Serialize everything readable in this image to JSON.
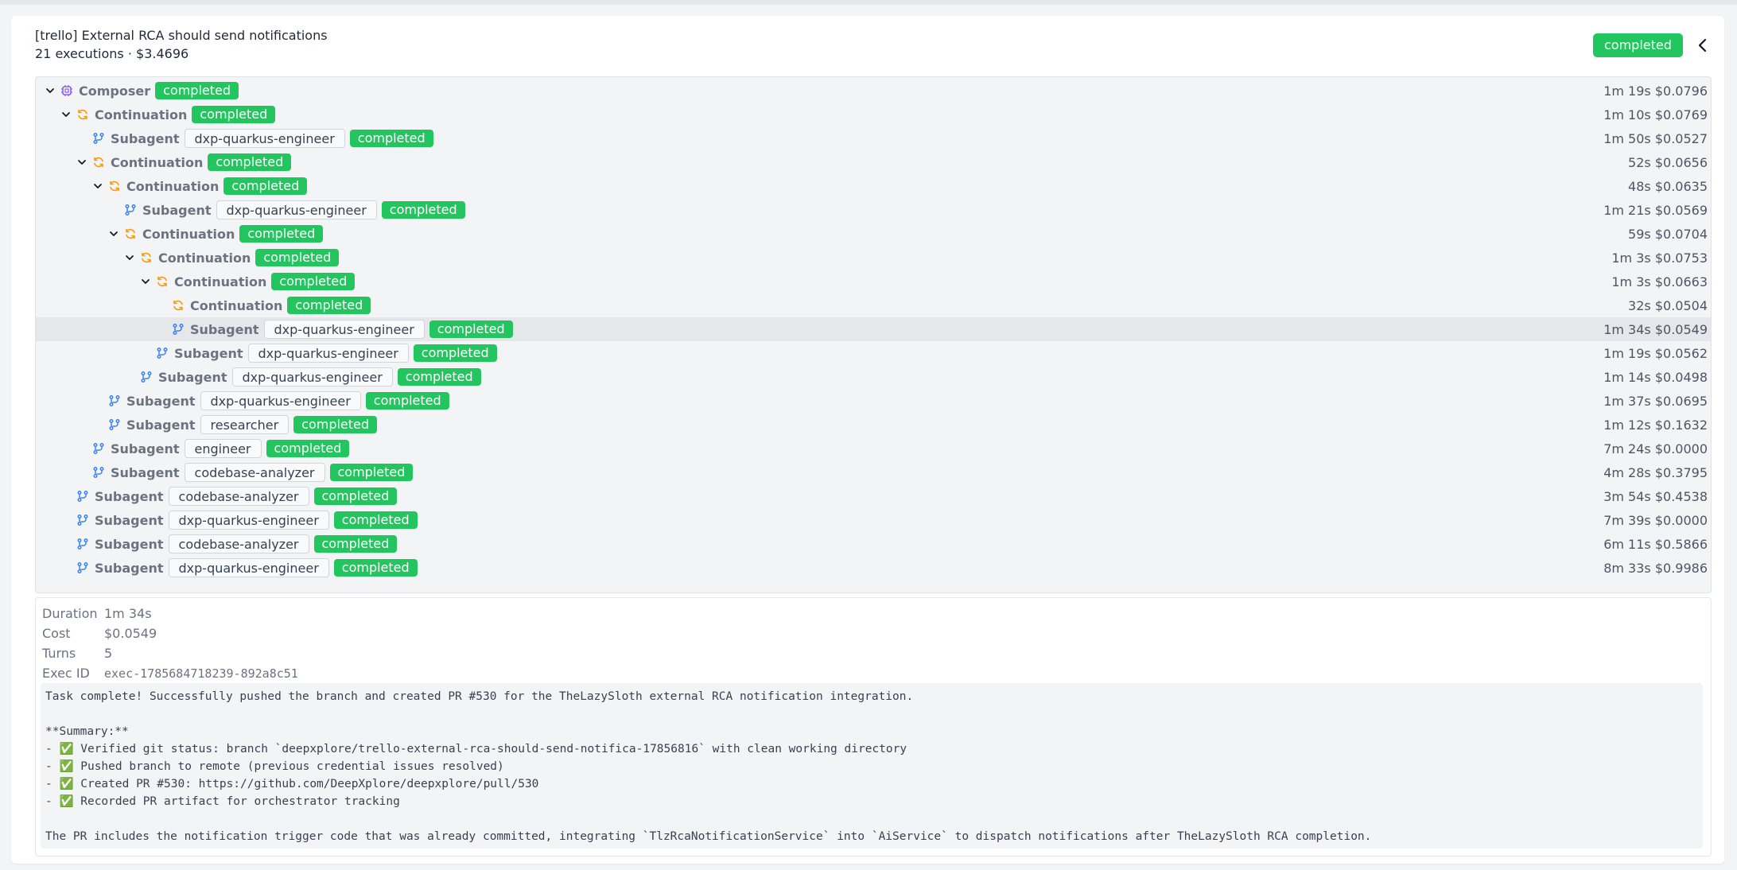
{
  "header": {
    "title": "[trello] External RCA should send notifications",
    "subtitle": "21 executions · $3.4696",
    "status": "completed"
  },
  "tree": [
    {
      "depth": 0,
      "expander": "expanded",
      "type": "composer",
      "label": "Composer",
      "status": "completed",
      "metrics": "1m 19s $0.0796"
    },
    {
      "depth": 1,
      "expander": "expanded",
      "type": "continuation",
      "label": "Continuation",
      "status": "completed",
      "metrics": "1m 10s $0.0769"
    },
    {
      "depth": 2,
      "expander": "none",
      "type": "subagent",
      "label": "Subagent",
      "agent": "dxp-quarkus-engineer",
      "status": "completed",
      "metrics": "1m 50s $0.0527"
    },
    {
      "depth": 2,
      "expander": "expanded",
      "type": "continuation",
      "label": "Continuation",
      "status": "completed",
      "metrics": "52s $0.0656"
    },
    {
      "depth": 3,
      "expander": "expanded",
      "type": "continuation",
      "label": "Continuation",
      "status": "completed",
      "metrics": "48s $0.0635"
    },
    {
      "depth": 4,
      "expander": "none",
      "type": "subagent",
      "label": "Subagent",
      "agent": "dxp-quarkus-engineer",
      "status": "completed",
      "metrics": "1m 21s $0.0569"
    },
    {
      "depth": 4,
      "expander": "expanded",
      "type": "continuation",
      "label": "Continuation",
      "status": "completed",
      "metrics": "59s $0.0704"
    },
    {
      "depth": 5,
      "expander": "expanded",
      "type": "continuation",
      "label": "Continuation",
      "status": "completed",
      "metrics": "1m 3s $0.0753"
    },
    {
      "depth": 6,
      "expander": "expanded",
      "type": "continuation",
      "label": "Continuation",
      "status": "completed",
      "metrics": "1m 3s $0.0663"
    },
    {
      "depth": 7,
      "expander": "none",
      "type": "continuation",
      "label": "Continuation",
      "status": "completed",
      "metrics": "32s $0.0504"
    },
    {
      "depth": 7,
      "expander": "none",
      "type": "subagent",
      "label": "Subagent",
      "agent": "dxp-quarkus-engineer",
      "status": "completed",
      "metrics": "1m 34s $0.0549",
      "selected": true
    },
    {
      "depth": 6,
      "expander": "none",
      "type": "subagent",
      "label": "Subagent",
      "agent": "dxp-quarkus-engineer",
      "status": "completed",
      "metrics": "1m 19s $0.0562"
    },
    {
      "depth": 5,
      "expander": "none",
      "type": "subagent",
      "label": "Subagent",
      "agent": "dxp-quarkus-engineer",
      "status": "completed",
      "metrics": "1m 14s $0.0498"
    },
    {
      "depth": 3,
      "expander": "none",
      "type": "subagent",
      "label": "Subagent",
      "agent": "dxp-quarkus-engineer",
      "status": "completed",
      "metrics": "1m 37s $0.0695"
    },
    {
      "depth": 3,
      "expander": "none",
      "type": "subagent",
      "label": "Subagent",
      "agent": "researcher",
      "status": "completed",
      "metrics": "1m 12s $0.1632"
    },
    {
      "depth": 2,
      "expander": "none",
      "type": "subagent",
      "label": "Subagent",
      "agent": "engineer",
      "status": "completed",
      "metrics": "7m 24s $0.0000"
    },
    {
      "depth": 2,
      "expander": "none",
      "type": "subagent",
      "label": "Subagent",
      "agent": "codebase-analyzer",
      "status": "completed",
      "metrics": "4m 28s $0.3795"
    },
    {
      "depth": 1,
      "expander": "none",
      "type": "subagent",
      "label": "Subagent",
      "agent": "codebase-analyzer",
      "status": "completed",
      "metrics": "3m 54s $0.4538"
    },
    {
      "depth": 1,
      "expander": "none",
      "type": "subagent",
      "label": "Subagent",
      "agent": "dxp-quarkus-engineer",
      "status": "completed",
      "metrics": "7m 39s $0.0000"
    },
    {
      "depth": 1,
      "expander": "none",
      "type": "subagent",
      "label": "Subagent",
      "agent": "codebase-analyzer",
      "status": "completed",
      "metrics": "6m 11s $0.5866"
    },
    {
      "depth": 1,
      "expander": "none",
      "type": "subagent",
      "label": "Subagent",
      "agent": "dxp-quarkus-engineer",
      "status": "completed",
      "metrics": "8m 33s $0.9986"
    }
  ],
  "details": {
    "duration_label": "Duration",
    "duration": "1m 34s",
    "cost_label": "Cost",
    "cost": "$0.0549",
    "turns_label": "Turns",
    "turns": "5",
    "exec_id_label": "Exec ID",
    "exec_id": "exec-1785684718239-892a8c51",
    "output": "Task complete! Successfully pushed the branch and created PR #530 for the TheLazySloth external RCA notification integration.\n\n**Summary:**\n- ✅ Verified git status: branch `deepxplore/trello-external-rca-should-send-notifica-17856816` with clean working directory\n- ✅ Pushed branch to remote (previous credential issues resolved)\n- ✅ Created PR #530: https://github.com/DeepXplore/deepxplore/pull/530\n- ✅ Recorded PR artifact for orchestrator tracking\n\nThe PR includes the notification trigger code that was already committed, integrating `TlzRcaNotificationService` into `AiService` to dispatch notifications after TheLazySloth RCA completion."
  },
  "colors": {
    "status_green": "#22c55e",
    "composer_icon": "#8b5cf6",
    "continuation_icon": "#f59e0b",
    "subagent_icon": "#3b82f6"
  }
}
